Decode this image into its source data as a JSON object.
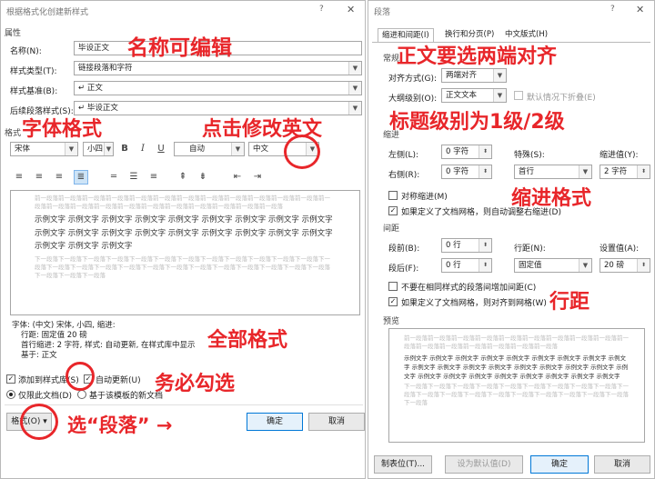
{
  "left_dialog": {
    "title": "根据格式化创建新样式",
    "help": "?",
    "close": "✕",
    "section_properties": "属性",
    "name_label": "名称(N):",
    "name_value": "毕设正文",
    "type_label": "样式类型(T):",
    "type_value": "链接段落和字符",
    "based_label": "样式基准(B):",
    "based_value": "↵ 正文",
    "next_label": "后续段落样式(S):",
    "next_value": "↵ 毕设正文",
    "section_format": "格式",
    "font_value": "宋体",
    "size_value": "小四",
    "bold": "B",
    "italic": "I",
    "underline": "U",
    "color_value": "自动",
    "lang_value": "中文",
    "preview_prev": "前一段落前一段落前一段落前一段落前一段落前一段落前一段落前一段落前一段落前一段落前一段落前一段落前一段落前一段落前一段落前一段落前一段落前一段落前一段落前一段落前一段落前一段落前一段落",
    "preview_sample": "示例文字 示例文字 示例文字 示例文字 示例文字 示例文字 示例文字 示例文字 示例文字 示例文字 示例文字 示例文字 示例文字 示例文字 示例文字 示例文字 示例文字 示例文字 示例文字 示例文字 示例文字",
    "preview_next": "下一段落下一段落下一段落下一段落下一段落下一段落下一段落下一段落下一段落下一段落下一段落下一段落下一段落下一段落下一段落下一段落下一段落下一段落下一段落下一段落下一段落下一段落下一段落下一段落下一段落下一段落下一段落下一段落",
    "desc_line1": "字体: (中文) 宋体, 小四, 缩进:",
    "desc_line2": "行距: 固定值 20 磅",
    "desc_line3": "首行缩进: 2 字符, 样式: 自动更新, 在样式库中显示",
    "desc_line4": "基于: 正文",
    "add_gallery": "添加到样式库(S)",
    "auto_update": "自动更新(U)",
    "only_doc": "仅限此文档(D)",
    "new_docs": "基于该模板的新文档",
    "format_btn": "格式(O) ▾",
    "ok": "确定",
    "cancel": "取消"
  },
  "right_dialog": {
    "title": "段落",
    "help": "?",
    "close": "✕",
    "tabs": [
      "缩进和间距(I)",
      "换行和分页(P)",
      "中文版式(H)"
    ],
    "section_general": "常规",
    "align_label": "对齐方式(G):",
    "align_value": "两端对齐",
    "outline_label": "大纲级别(O):",
    "outline_value": "正文文本",
    "collapse_label": "默认情况下折叠(E)",
    "section_indent": "缩进",
    "left_label": "左侧(L):",
    "left_value": "0 字符",
    "right_label": "右侧(R):",
    "right_value": "0 字符",
    "special_label": "特殊(S):",
    "special_value": "首行",
    "indent_by_label": "缩进值(Y):",
    "indent_by_value": "2 字符",
    "mirror_label": "对称缩进(M)",
    "auto_right_label": "如果定义了文档网格，则自动调整右缩进(D)",
    "section_spacing": "间距",
    "before_label": "段前(B):",
    "before_value": "0 行",
    "after_label": "段后(F):",
    "after_value": "0 行",
    "line_label": "行距(N):",
    "line_value": "固定值",
    "at_label": "设置值(A):",
    "at_value": "20 磅",
    "no_space_label": "不要在相同样式的段落间增加间距(C)",
    "snap_grid_label": "如果定义了文档网格，则对齐到网格(W)",
    "section_preview": "预览",
    "preview_prev": "前一段落前一段落前一段落前一段落前一段落前一段落前一段落前一段落前一段落前一段落前一段落前一段落前一段落前一段落前一段落前一段落",
    "preview_sample": "示例文字 示例文字 示例文字 示例文字 示例文字 示例文字 示例文字 示例文字 示例文字 示例文字 示例文字 示例文字 示例文字 示例文字 示例文字 示例文字 示例文字 示例文字 示例文字 示例文字 示例文字 示例文字 示例文字 示例文字 示例文字 示例文字",
    "preview_next": "下一段落下一段落下一段落下一段落下一段落下一段落下一段落下一段落下一段落下一段落下一段落下一段落下一段落下一段落下一段落下一段落下一段落下一段落下一段落下一段落",
    "tabs_btn": "制表位(T)...",
    "default_btn": "设为默认值(D)",
    "ok": "确定",
    "cancel": "取消"
  },
  "annotations": {
    "name_editable": "名称可编辑",
    "font_format": "字体格式",
    "click_english": "点击修改英文",
    "all_format": "全部格式",
    "must_check": "务必勾选",
    "select_paragraph": "选“段落” →",
    "justify": "正文要选两端对齐",
    "title_level": "标题级别为1级/2级",
    "indent_format": "缩进格式",
    "line_spacing": "行距"
  },
  "colors": {
    "annotation": "#e8262a",
    "primary_border": "#0078d7"
  }
}
